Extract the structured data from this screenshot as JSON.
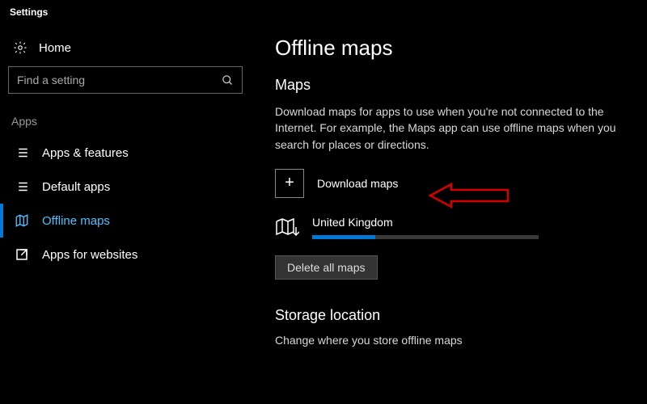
{
  "window": {
    "title": "Settings"
  },
  "sidebar": {
    "home_label": "Home",
    "search_placeholder": "Find a setting",
    "section_label": "Apps",
    "items": [
      {
        "label": "Apps & features"
      },
      {
        "label": "Default apps"
      },
      {
        "label": "Offline maps"
      },
      {
        "label": "Apps for websites"
      }
    ]
  },
  "main": {
    "title": "Offline maps",
    "maps_heading": "Maps",
    "maps_desc": "Download maps for apps to use when you're not connected to the Internet. For example, the Maps app can use offline maps when you search for places or directions.",
    "download_label": "Download maps",
    "map_item": {
      "name": "United Kingdom",
      "progress_pct": 28
    },
    "delete_label": "Delete all maps",
    "storage_heading": "Storage location",
    "storage_desc": "Change where you store offline maps"
  },
  "colors": {
    "accent": "#0078d7",
    "active_text": "#4cc2ff"
  }
}
